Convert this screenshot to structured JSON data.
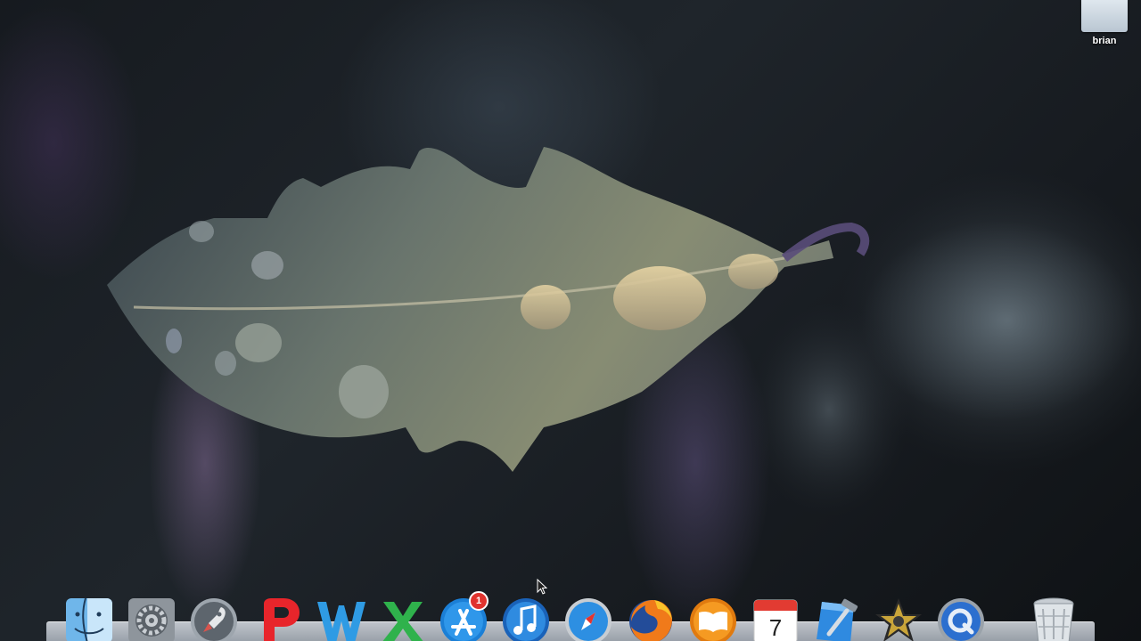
{
  "desktop": {
    "drive_label": "brian"
  },
  "dock": {
    "items": [
      {
        "name": "finder",
        "icon": "finder-icon"
      },
      {
        "name": "system-preferences",
        "icon": "gear-icon"
      },
      {
        "name": "launchpad",
        "icon": "rocket-icon"
      },
      {
        "name": "pages",
        "icon": "pages-p-icon",
        "glyph": "P",
        "color": "#e8252b"
      },
      {
        "name": "word",
        "icon": "word-w-icon",
        "glyph": "W",
        "color": "#2f9be4"
      },
      {
        "name": "excel",
        "icon": "excel-x-icon",
        "glyph": "X",
        "color": "#2fb24c"
      },
      {
        "name": "app-store",
        "icon": "app-store-icon",
        "badge": "1"
      },
      {
        "name": "itunes",
        "icon": "music-note-icon"
      },
      {
        "name": "safari",
        "icon": "compass-icon"
      },
      {
        "name": "firefox",
        "icon": "firefox-icon"
      },
      {
        "name": "ibooks",
        "icon": "book-icon"
      },
      {
        "name": "calendar",
        "icon": "calendar-icon",
        "day": "7"
      },
      {
        "name": "xcode",
        "icon": "hammer-icon"
      },
      {
        "name": "imovie",
        "icon": "star-icon"
      },
      {
        "name": "quicktime",
        "icon": "quicktime-icon"
      },
      {
        "name": "trash",
        "icon": "trash-icon"
      }
    ]
  },
  "colors": {
    "badge": "#e0332e",
    "dock_shelf": "#c8ced6"
  }
}
